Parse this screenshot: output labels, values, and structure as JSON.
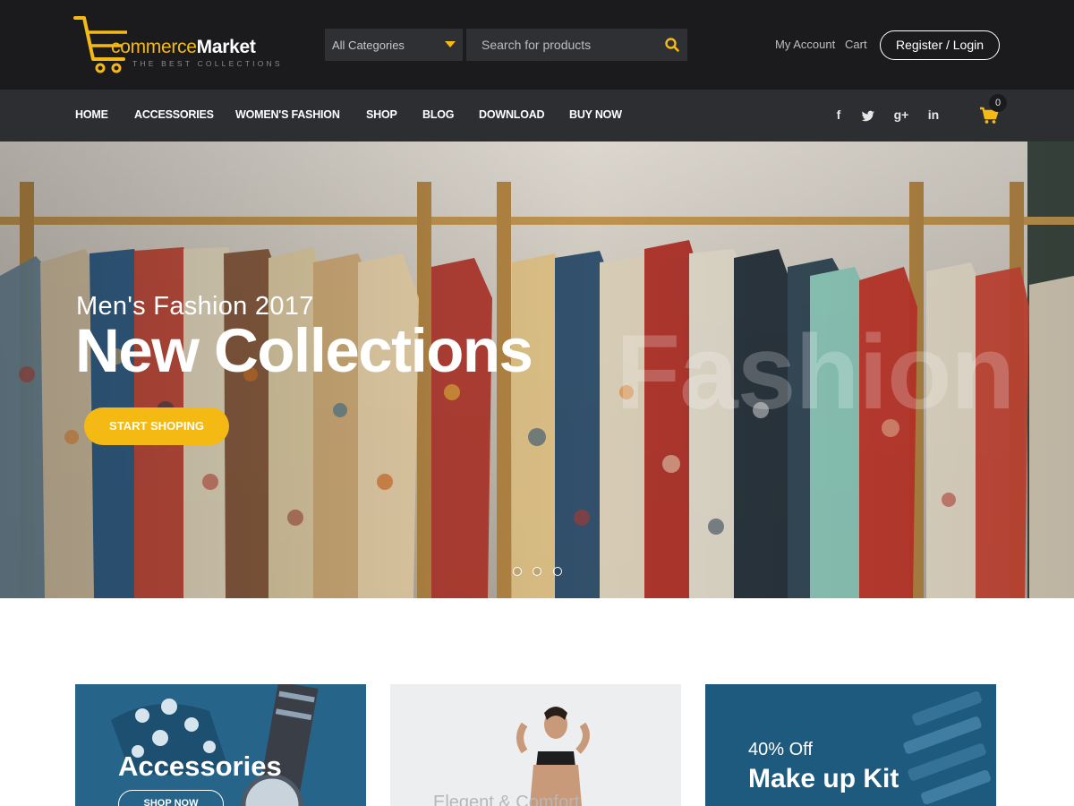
{
  "header": {
    "logo": {
      "brand_prefix": "commerce",
      "brand_main": "Market",
      "tagline": "THE BEST COLLECTIONS"
    },
    "category_select": {
      "selected": "All Categories"
    },
    "search": {
      "placeholder": "Search for products",
      "icon": "search-icon"
    },
    "links": {
      "my_account": "My Account",
      "cart": "Cart"
    },
    "register_login": "Register / Login"
  },
  "nav": {
    "items": [
      "HOME",
      "ACCESSORIES",
      "WOMEN'S FASHION",
      "SHOP",
      "BLOG",
      "DOWNLOAD",
      "BUY NOW"
    ],
    "social": {
      "facebook": "f",
      "twitter": "twitter-icon",
      "google_plus": "g+",
      "linkedin": "in"
    },
    "cart_count": "0"
  },
  "hero": {
    "subtitle": "Men's Fashion 2017",
    "title": "New Collections",
    "watermark": "Fashion",
    "cta": "START SHOPING",
    "slides": 3
  },
  "promos": [
    {
      "title": "Accessories",
      "button": "SHOP NOW"
    },
    {
      "subtitle": "Elegent & Comfort"
    },
    {
      "discount": "40% Off",
      "title": "Make up Kit"
    }
  ],
  "colors": {
    "accent": "#f5b914",
    "header_bg": "#1b1b1d",
    "nav_bg": "#2d2e32",
    "promo_blue": "#27648a"
  }
}
